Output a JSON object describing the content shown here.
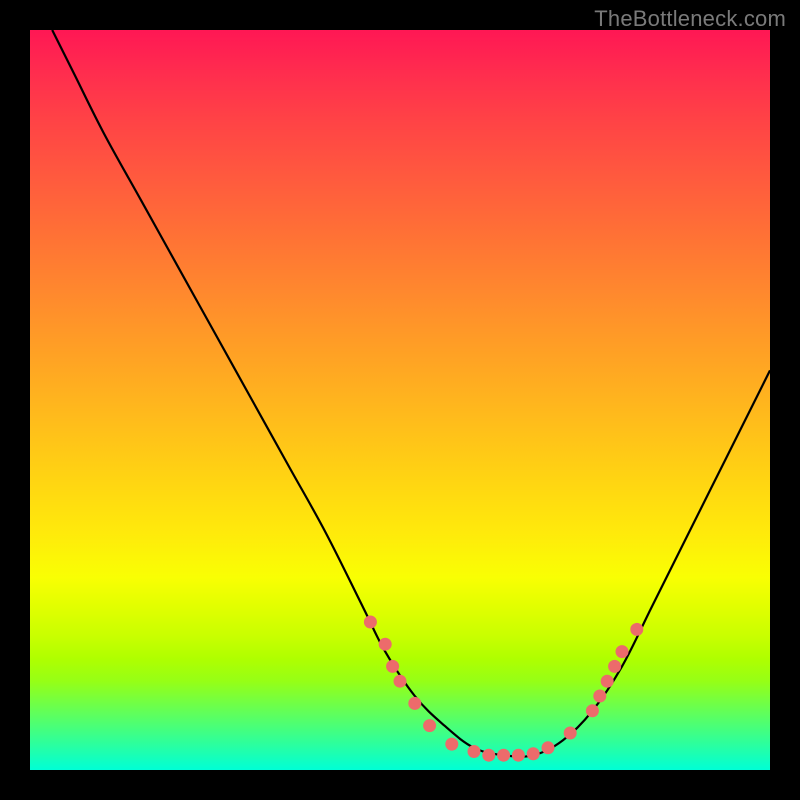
{
  "watermark": "TheBottleneck.com",
  "colors": {
    "curve": "#000000",
    "dot_fill": "#ec6b6b",
    "dot_stroke": "#c94f4f"
  },
  "chart_data": {
    "type": "line",
    "title": "",
    "xlabel": "",
    "ylabel": "",
    "xlim": [
      0,
      100
    ],
    "ylim": [
      0,
      100
    ],
    "series": [
      {
        "name": "curve",
        "x": [
          3,
          6,
          10,
          15,
          20,
          25,
          30,
          35,
          40,
          45,
          48,
          52,
          56,
          60,
          64,
          68,
          72,
          76,
          80,
          84,
          88,
          92,
          96,
          100
        ],
        "y": [
          100,
          94,
          86,
          77,
          68,
          59,
          50,
          41,
          32,
          22,
          16,
          10,
          6,
          3,
          2,
          2,
          4,
          8,
          14,
          22,
          30,
          38,
          46,
          54
        ]
      }
    ],
    "dots": {
      "name": "markers",
      "points": [
        {
          "x": 46,
          "y": 20
        },
        {
          "x": 48,
          "y": 17
        },
        {
          "x": 49,
          "y": 14
        },
        {
          "x": 50,
          "y": 12
        },
        {
          "x": 52,
          "y": 9
        },
        {
          "x": 54,
          "y": 6
        },
        {
          "x": 57,
          "y": 3.5
        },
        {
          "x": 60,
          "y": 2.5
        },
        {
          "x": 62,
          "y": 2
        },
        {
          "x": 64,
          "y": 2
        },
        {
          "x": 66,
          "y": 2
        },
        {
          "x": 68,
          "y": 2.2
        },
        {
          "x": 70,
          "y": 3
        },
        {
          "x": 73,
          "y": 5
        },
        {
          "x": 76,
          "y": 8
        },
        {
          "x": 77,
          "y": 10
        },
        {
          "x": 78,
          "y": 12
        },
        {
          "x": 79,
          "y": 14
        },
        {
          "x": 80,
          "y": 16
        },
        {
          "x": 82,
          "y": 19
        }
      ]
    }
  }
}
